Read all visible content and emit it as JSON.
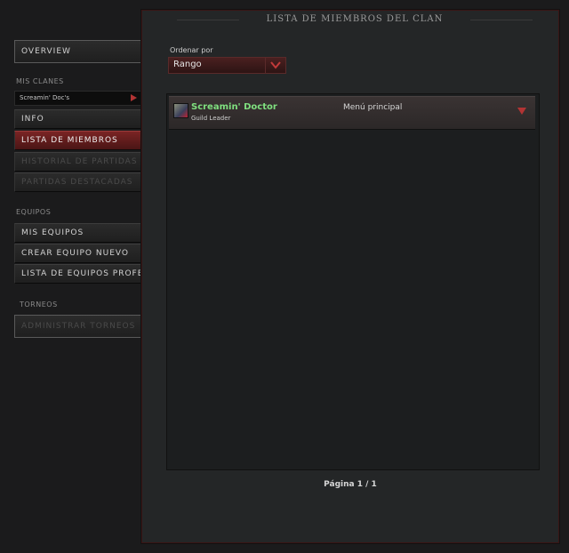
{
  "sidebar": {
    "overview_label": "OVERVIEW",
    "my_clans_heading": "MIS CLANES",
    "clan_select_value": "Screamin' Doc's",
    "clan_items": [
      {
        "label": "INFO",
        "state": "normal"
      },
      {
        "label": "LISTA DE MIEMBROS",
        "state": "active"
      },
      {
        "label": "HISTORIAL DE PARTIDAS",
        "state": "disabled"
      },
      {
        "label": "PARTIDAS DESTACADAS",
        "state": "disabled"
      }
    ],
    "teams_heading": "EQUIPOS",
    "team_items": [
      {
        "label": "MIS EQUIPOS"
      },
      {
        "label": "CREAR EQUIPO NUEVO"
      },
      {
        "label": "LISTA DE EQUIPOS PROFESIONALES"
      }
    ],
    "tournaments_heading": "TORNEOS",
    "tournament_items": [
      {
        "label": "ADMINISTRAR TORNEOS",
        "state": "disabled"
      }
    ]
  },
  "panel": {
    "title": "LISTA DE MIEMBROS DEL CLAN",
    "sort_label": "Ordenar por",
    "sort_value": "Rango",
    "members": [
      {
        "name": "Screamin' Doctor",
        "role": "Guild Leader",
        "menu_label": "Menú principal"
      }
    ],
    "page_label": "Página 1 / 1"
  },
  "colors": {
    "accent": "#b23434",
    "active_item": "#7a2424",
    "member_name": "#7fe07f"
  }
}
